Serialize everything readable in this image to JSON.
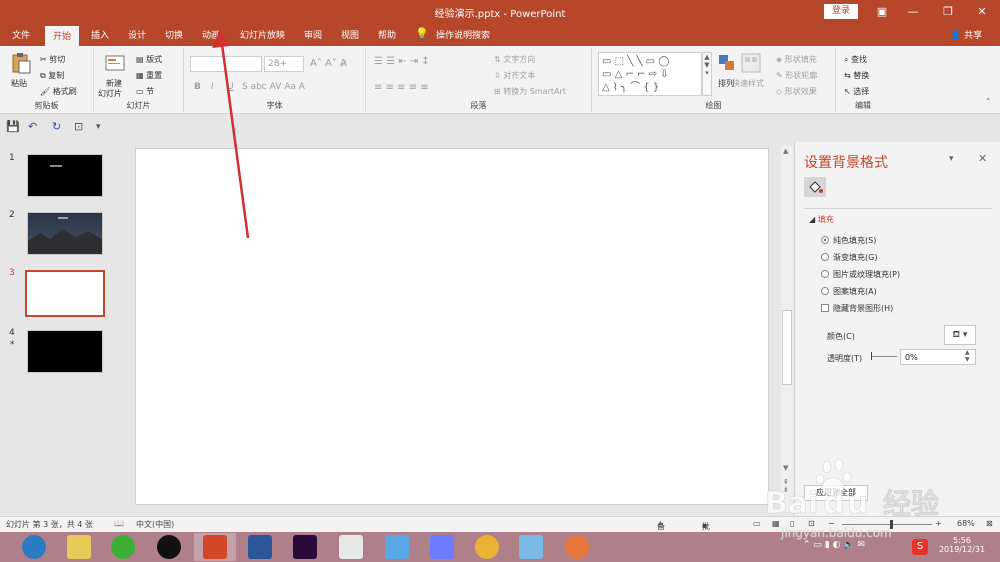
{
  "titlebar": {
    "title": "经验演示.pptx - PowerPoint",
    "login": "登录"
  },
  "tabs": [
    "文件",
    "开始",
    "插入",
    "设计",
    "切换",
    "动画",
    "幻灯片放映",
    "审阅",
    "视图",
    "帮助",
    "操作说明搜索"
  ],
  "active_tab": "开始",
  "share": "共享",
  "ribbon": {
    "clipboard": {
      "paste": "粘贴",
      "cut": "剪切",
      "copy": "复制",
      "format_painter": "格式刷",
      "label": "剪贴板"
    },
    "slides": {
      "new_slide": "新建",
      "new_slide2": "幻灯片",
      "layout": "版式",
      "reset": "重置",
      "section": "节",
      "label": "幻灯片"
    },
    "font": {
      "size": "28+",
      "label": "字体"
    },
    "paragraph": {
      "text_direction": "文字方向",
      "align_text": "对齐文本",
      "smartart": "转换为 SmartArt",
      "label": "段落"
    },
    "drawing": {
      "arrange": "排列",
      "quick_styles": "快速样式",
      "shape_fill": "形状填充",
      "shape_outline": "形状轮廓",
      "shape_effects": "形状效果",
      "label": "绘图"
    },
    "editing": {
      "find": "查找",
      "replace": "替换",
      "select": "选择",
      "label": "编辑"
    }
  },
  "thumbnails": [
    {
      "num": "1"
    },
    {
      "num": "2"
    },
    {
      "num": "3"
    },
    {
      "num": "4",
      "star": "*"
    }
  ],
  "selected_slide": "3",
  "pane": {
    "title": "设置背景格式",
    "section": "填充",
    "options": [
      "纯色填充(S)",
      "渐变填充(G)",
      "图片或纹理填充(P)",
      "图案填充(A)"
    ],
    "selected_option": "纯色填充(S)",
    "hide_bg": "隐藏背景图形(H)",
    "color_label": "颜色(C)",
    "transparency_label": "透明度(T)",
    "transparency_value": "0%",
    "apply_all": "应用到全部"
  },
  "status": {
    "slide_info": "幻灯片 第 3 张，共 4 张",
    "language": "中文(中国)",
    "notes": "备注",
    "comments": "批注",
    "zoom": "68%"
  },
  "taskbar": {
    "time": "5:56",
    "date": "2019/12/31"
  },
  "colors": {
    "accent": "#b7472a",
    "selection": "#c5462b",
    "arrow": "#d0302e"
  }
}
